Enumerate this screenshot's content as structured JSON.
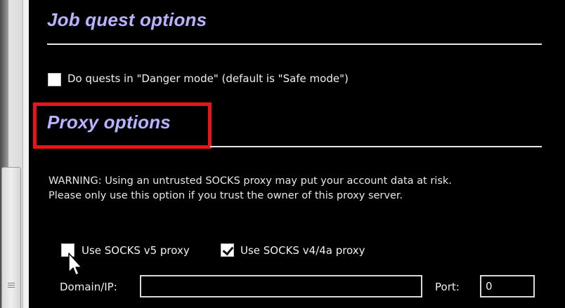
{
  "job_quest_options": {
    "title": "Job quest options",
    "danger_mode_label": "Do quests in \"Danger mode\" (default is \"Safe mode\")",
    "danger_mode_checked": false
  },
  "proxy_options": {
    "title": "Proxy options",
    "warning_line1": "WARNING: Using an untrusted SOCKS proxy may put your account data at risk.",
    "warning_line2": "Please only use this option if you trust the owner of this proxy server.",
    "socks5_label": "Use SOCKS v5 proxy",
    "socks5_checked": false,
    "socks4_label": "Use SOCKS v4/4a proxy",
    "socks4_checked": true,
    "domain_label": "Domain/IP:",
    "domain_value": "",
    "port_label": "Port:",
    "port_value": "0"
  },
  "colors": {
    "section_title": "#b8b2ff",
    "highlight": "#e8141a",
    "background": "#000000"
  }
}
